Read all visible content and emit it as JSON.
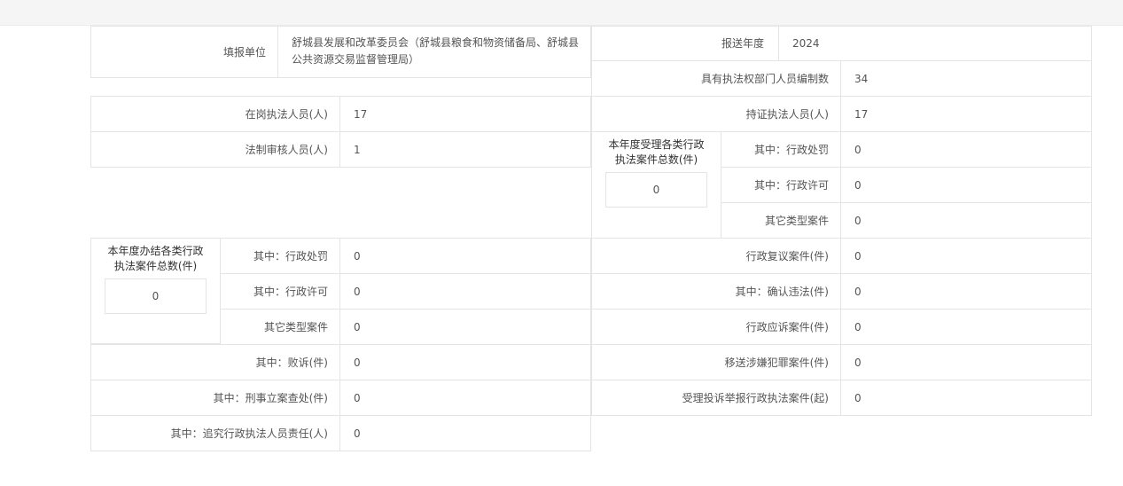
{
  "report": {
    "unit_label": "填报单位",
    "unit_value": "舒城县发展和改革委员会（舒城县粮食和物资储备局、舒城县公共资源交易监督管理局）",
    "year_label": "报送年度",
    "year_value": "2024",
    "staffing_label": "具有执法权部门人员编制数",
    "staffing_value": "34",
    "onduty_label": "在岗执法人员(人)",
    "onduty_value": "17",
    "certified_label": "持证执法人员(人)",
    "certified_value": "17",
    "legal_review_label": "法制审核人员(人)",
    "legal_review_value": "1",
    "accepted": {
      "title": "本年度受理各类行政执法案件总数(件)",
      "total": "0",
      "penalty_label": "其中：行政处罚",
      "penalty_value": "0",
      "license_label": "其中：行政许可",
      "license_value": "0",
      "other_label": "其它类型案件",
      "other_value": "0"
    },
    "concluded": {
      "title": "本年度办结各类行政执法案件总数(件)",
      "total": "0",
      "penalty_label": "其中：行政处罚",
      "penalty_value": "0",
      "license_label": "其中：行政许可",
      "license_value": "0",
      "other_label": "其它类型案件",
      "other_value": "0"
    },
    "reconsider_label": "行政复议案件(件)",
    "reconsider_value": "0",
    "confirm_illegal_label": "其中：确认违法(件)",
    "confirm_illegal_value": "0",
    "litigation_label": "行政应诉案件(件)",
    "litigation_value": "0",
    "lost_label": "其中：败诉(件)",
    "lost_value": "0",
    "transfer_label": "移送涉嫌犯罪案件(件)",
    "transfer_value": "0",
    "criminal_label": "其中：刑事立案查处(件)",
    "criminal_value": "0",
    "complaint_label": "受理投诉举报行政执法案件(起)",
    "complaint_value": "0",
    "accountability_label": "其中：追究行政执法人员责任(人)",
    "accountability_value": "0"
  }
}
